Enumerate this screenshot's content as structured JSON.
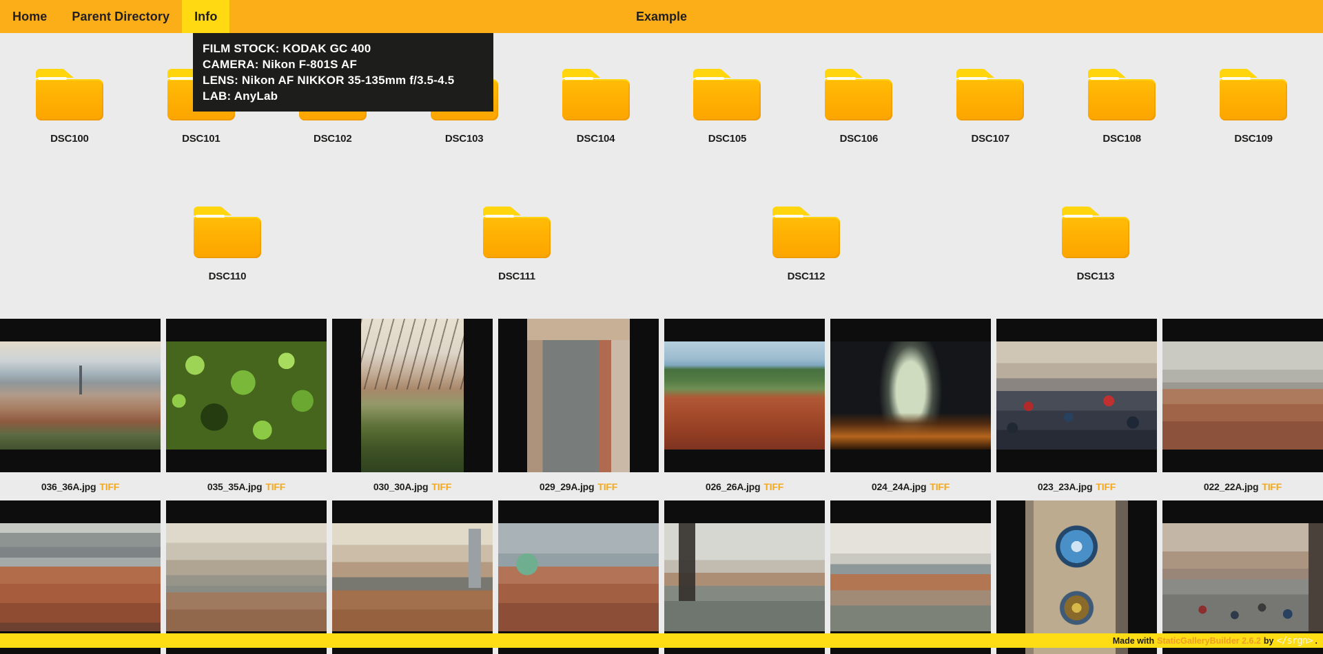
{
  "nav": {
    "items": [
      {
        "label": "Home",
        "active": false
      },
      {
        "label": "Parent Directory",
        "active": false
      },
      {
        "label": "Info",
        "active": true
      }
    ],
    "title": "Example"
  },
  "info_tooltip": {
    "lines": [
      "FILM STOCK: KODAK GC 400",
      "CAMERA: Nikon F-801S AF",
      "LENS: Nikon AF NIKKOR 35-135mm f/3.5-4.5",
      "LAB: AnyLab"
    ]
  },
  "folders": {
    "rows": [
      [
        "DSC100",
        "DSC101",
        "DSC102",
        "DSC103",
        "DSC104",
        "DSC105",
        "DSC106",
        "DSC107",
        "DSC108",
        "DSC109"
      ],
      [
        "DSC110",
        "DSC111",
        "DSC112",
        "DSC113"
      ]
    ]
  },
  "gallery": {
    "rows": [
      [
        {
          "file": "036_36A.jpg",
          "format": "TIFF",
          "style": "ph036",
          "orientation": "landscape"
        },
        {
          "file": "035_35A.jpg",
          "format": "TIFF",
          "style": "ph035",
          "orientation": "landscape"
        },
        {
          "file": "030_30A.jpg",
          "format": "TIFF",
          "style": "ph030",
          "orientation": "portrait"
        },
        {
          "file": "029_29A.jpg",
          "format": "TIFF",
          "style": "ph029",
          "orientation": "portrait"
        },
        {
          "file": "026_26A.jpg",
          "format": "TIFF",
          "style": "ph026",
          "orientation": "landscape"
        },
        {
          "file": "024_24A.jpg",
          "format": "TIFF",
          "style": "ph024",
          "orientation": "landscape"
        },
        {
          "file": "023_23A.jpg",
          "format": "TIFF",
          "style": "ph023",
          "orientation": "landscape"
        },
        {
          "file": "022_22A.jpg",
          "format": "TIFF",
          "style": "ph022",
          "orientation": "landscape"
        }
      ],
      [
        {
          "file": "",
          "format": "",
          "style": "phr41",
          "orientation": "landscape"
        },
        {
          "file": "",
          "format": "",
          "style": "phr42",
          "orientation": "landscape"
        },
        {
          "file": "",
          "format": "",
          "style": "phr43",
          "orientation": "landscape"
        },
        {
          "file": "",
          "format": "",
          "style": "phr44",
          "orientation": "landscape"
        },
        {
          "file": "",
          "format": "",
          "style": "phr45",
          "orientation": "landscape"
        },
        {
          "file": "",
          "format": "",
          "style": "phr46",
          "orientation": "landscape"
        },
        {
          "file": "",
          "format": "",
          "style": "phr47",
          "orientation": "portrait"
        },
        {
          "file": "",
          "format": "",
          "style": "phr48",
          "orientation": "landscape"
        }
      ]
    ]
  },
  "footer": {
    "made_with": "Made with",
    "builder_link": "StaticGalleryBuilder 2.6.2",
    "by": "by",
    "brand": "</srgn>",
    "suffix": "."
  },
  "colors": {
    "nav_bg": "#FBAE17",
    "active_tab_bg": "#FFD911",
    "footer_bg": "#FFDD15",
    "accent_link": "#F5A81C",
    "folder_body": "#FFAE02",
    "folder_tab": "#FFD60D",
    "tooltip_bg": "#1D1D1B",
    "page_bg": "#EBEBEB",
    "thumb_bg": "#0D0D0D"
  }
}
